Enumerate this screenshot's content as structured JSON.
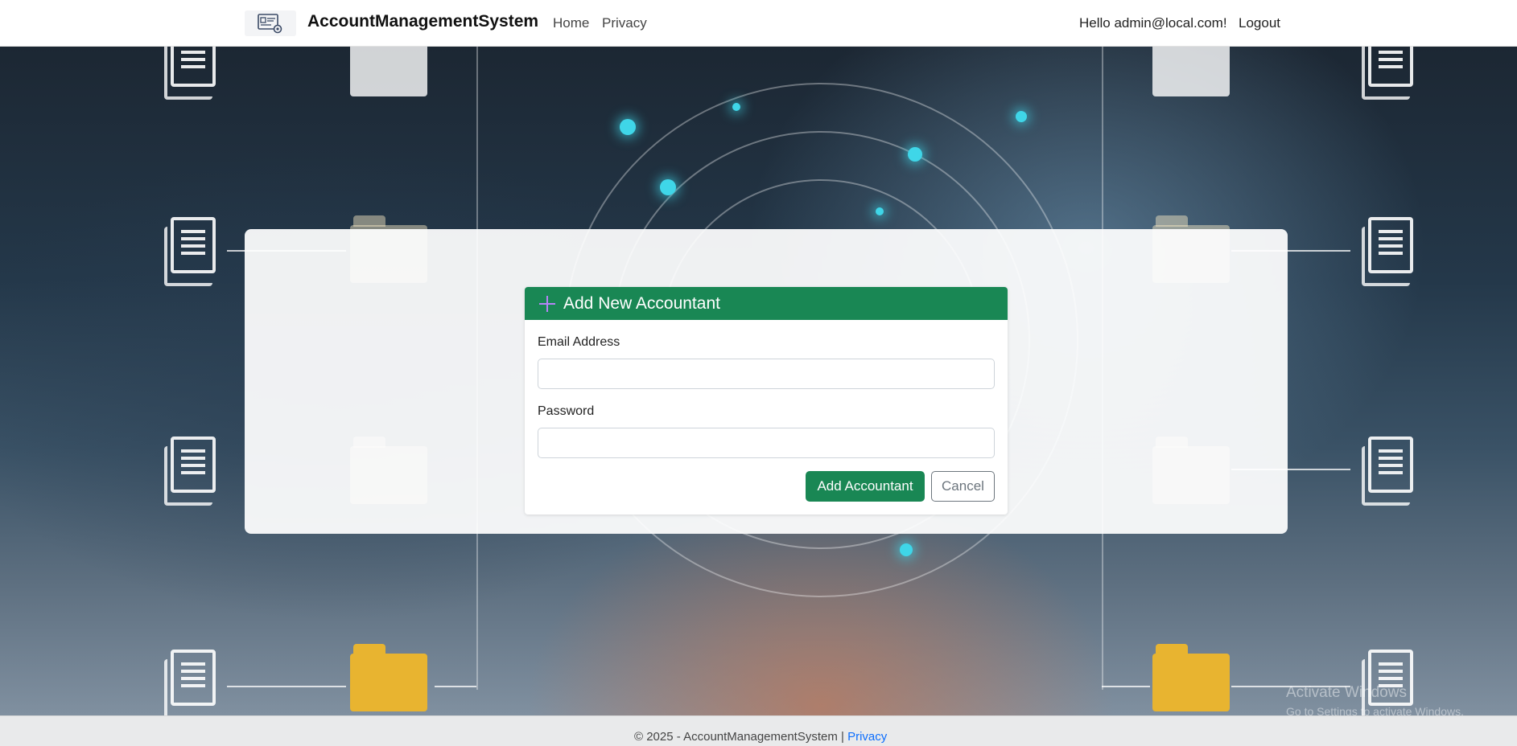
{
  "navbar": {
    "brand": "AccountManagementSystem",
    "links": [
      {
        "label": "Home"
      },
      {
        "label": "Privacy"
      }
    ],
    "greeting": "Hello admin@local.com!",
    "logout_label": "Logout"
  },
  "form": {
    "title": "Add New Accountant",
    "email_label": "Email Address",
    "email_value": "",
    "password_label": "Password",
    "password_value": "",
    "submit_label": "Add Accountant",
    "cancel_label": "Cancel"
  },
  "footer": {
    "text": "© 2025 - AccountManagementSystem |",
    "privacy_label": "Privacy"
  },
  "watermark": {
    "title": "Activate Windows",
    "subtitle": "Go to Settings to activate Windows."
  },
  "colors": {
    "primary_green": "#198754",
    "link_blue": "#0d6efd",
    "plus_icon": "#b784f7"
  }
}
